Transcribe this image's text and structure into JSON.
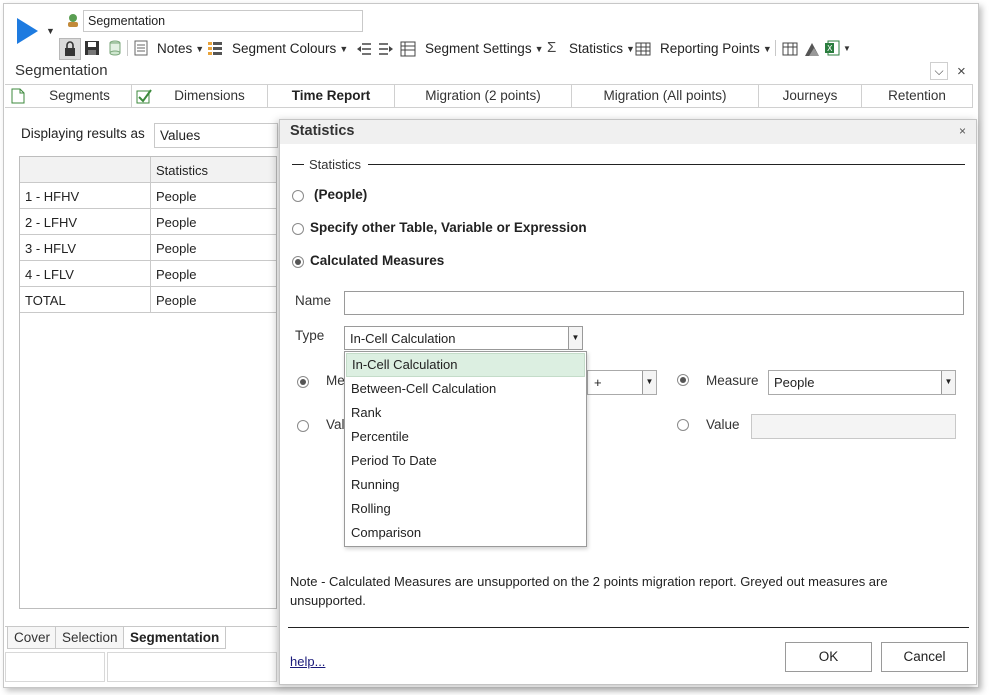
{
  "toolbar": {
    "title_value": "Segmentation",
    "notes_label": "Notes",
    "segment_colours_label": "Segment Colours",
    "segment_settings_label": "Segment Settings",
    "statistics_label": "Statistics",
    "reporting_points_label": "Reporting Points",
    "accent_color": "#1e7be0"
  },
  "app": {
    "title": "Segmentation",
    "pin_glyph": "⌵",
    "close_glyph": "×"
  },
  "tabs": [
    {
      "label": "Segments"
    },
    {
      "label": "Dimensions"
    },
    {
      "label": "Time Report"
    },
    {
      "label": "Migration (2 points)"
    },
    {
      "label": "Migration (All points)"
    },
    {
      "label": "Journeys"
    },
    {
      "label": "Retention"
    }
  ],
  "left": {
    "displaying_label": "Displaying results as",
    "displaying_value": "Values",
    "grid_header": {
      "col1": "",
      "col2": "Statistics"
    },
    "rows": [
      {
        "segment": "1 - HFHV",
        "stat": "People"
      },
      {
        "segment": "2 - LFHV",
        "stat": "People"
      },
      {
        "segment": "3 - HFLV",
        "stat": "People"
      },
      {
        "segment": "4 - LFLV",
        "stat": "People"
      },
      {
        "segment": "TOTAL",
        "stat": "People"
      }
    ],
    "sheet_tabs": [
      "Cover",
      "Selection",
      "Segmentation"
    ]
  },
  "dialog": {
    "title": "Statistics",
    "close_glyph": "×",
    "group_label": "Statistics",
    "radio_people": "(People)",
    "radio_other": "Specify other Table, Variable or Expression",
    "radio_calc": "Calculated Measures",
    "name_label": "Name",
    "name_value": "",
    "type_label": "Type",
    "type_value": "In-Cell Calculation",
    "left_measure_label_partial": "Me",
    "left_value_label_partial": "Val",
    "operator_value": "+",
    "measure_label": "Measure",
    "measure_value": "People",
    "value_label": "Value",
    "value_value": "",
    "type_options": [
      "In-Cell Calculation",
      "Between-Cell Calculation",
      "Rank",
      "Percentile",
      "Period To Date",
      "Running",
      "Rolling",
      "Comparison"
    ],
    "note": "Note - Calculated Measures are unsupported on the 2 points migration report. Greyed out measures are unsupported.",
    "help_link": "help...",
    "ok_label": "OK",
    "cancel_label": "Cancel"
  }
}
